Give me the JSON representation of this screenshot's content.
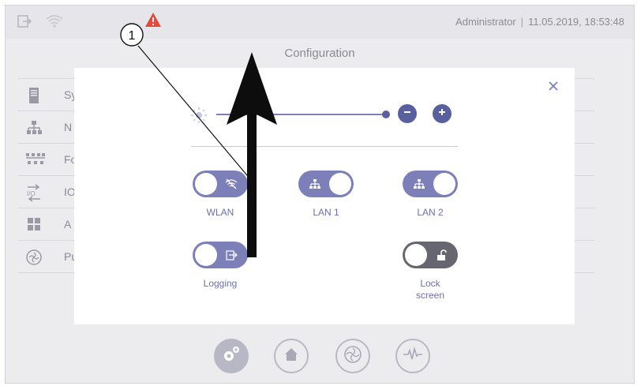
{
  "status": {
    "user": "Administrator",
    "separator": "|",
    "datetime": "11.05.2019, 18:53:48"
  },
  "page_title": "Configuration",
  "menu": {
    "items": [
      {
        "label": "Sy",
        "icon": "server-icon"
      },
      {
        "label": "N",
        "icon": "network-icon"
      },
      {
        "label": "Fo",
        "icon": "fieldbus-icon"
      },
      {
        "label": "IO",
        "icon": "io-icon"
      },
      {
        "label": "A",
        "icon": "apps-grid-icon"
      },
      {
        "label": "Pu",
        "icon": "pump-icon"
      }
    ]
  },
  "modal": {
    "brightness": {
      "level_percent": 100
    },
    "toggles": {
      "wlan": {
        "label": "WLAN",
        "state": "off"
      },
      "lan1": {
        "label": "LAN 1",
        "state": "on"
      },
      "lan2": {
        "label": "LAN 2",
        "state": "on"
      },
      "logging": {
        "label": "Logging",
        "state": "off"
      },
      "lock": {
        "label_line1": "Lock",
        "label_line2": "screen",
        "state": "off"
      }
    }
  },
  "callout": {
    "number": "1"
  },
  "colors": {
    "accent": "#5a5f9e",
    "toggle_on": "#7c7fb8",
    "toggle_grey": "#666670",
    "warning": "#e4493c"
  }
}
